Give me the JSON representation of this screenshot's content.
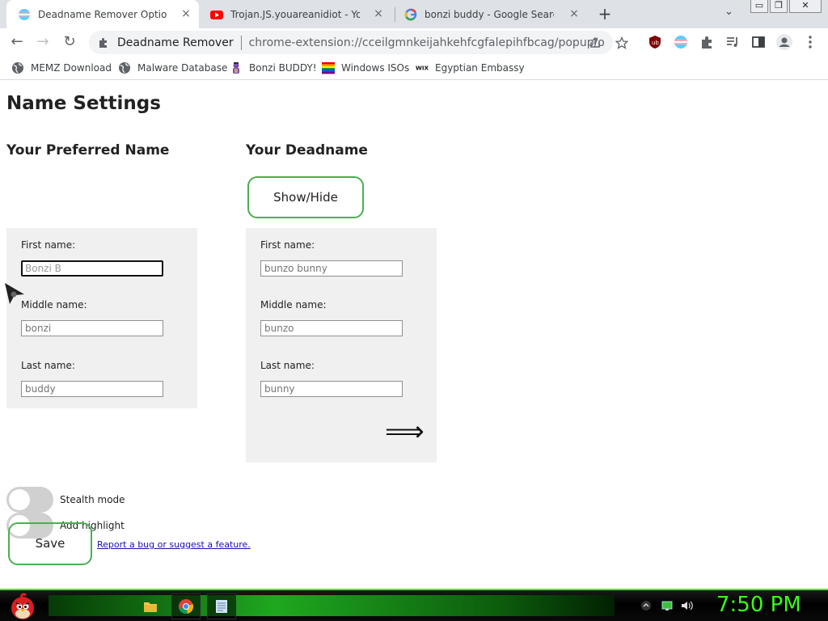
{
  "browser": {
    "tabs": [
      {
        "title": "Deadname Remover Options",
        "icon": "trans-flag-icon",
        "active": true
      },
      {
        "title": "Trojan.JS.youareanidiot - YouTube",
        "icon": "youtube-icon",
        "active": false
      },
      {
        "title": "bonzi buddy - Google Search",
        "icon": "google-icon",
        "active": false
      }
    ],
    "tab_close": "×",
    "new_tab": "+",
    "tab_search": "⌄",
    "window_buttons": [
      "▭",
      "❐",
      "✕"
    ],
    "nav": {
      "back": "←",
      "forward": "→",
      "reload": "↻"
    },
    "omnibox": {
      "site_name": "Deadname Remover",
      "url": "chrome-extension://cceilgmnkeijahkehfcgfalepihfbcag/popup/optio..."
    },
    "bookmarks": [
      {
        "label": "MEMZ Download",
        "icon": "globe-icon"
      },
      {
        "label": "Malware Database",
        "icon": "globe-icon"
      },
      {
        "label": "Bonzi BUDDY!",
        "icon": "bonzi-icon"
      },
      {
        "label": "Windows ISOs",
        "icon": "rainbow-flag-icon"
      },
      {
        "label": "Egyptian Embassy",
        "icon": "wix-icon"
      }
    ]
  },
  "page": {
    "title": "Name Settings",
    "preferred": {
      "heading": "Your Preferred Name",
      "first_label": "First name:",
      "first_value": "Bonzi B",
      "middle_label": "Middle name:",
      "middle_value": "bonzi",
      "last_label": "Last name:",
      "last_value": "buddy"
    },
    "deadname": {
      "heading": "Your Deadname",
      "show_hide": "Show/Hide",
      "first_label": "First name:",
      "first_value": "bunzo bunny",
      "middle_label": "Middle name:",
      "middle_value": "bunzo",
      "last_label": "Last name:",
      "last_value": "bunny",
      "arrow": "⟹"
    },
    "stealth_label": "Stealth mode",
    "stealth_on": false,
    "highlight_label": "Add highlight",
    "highlight_on": false,
    "save": "Save",
    "report_link": "Report a bug or suggest a feature."
  },
  "taskbar": {
    "clock": "7:50 PM",
    "accent": "#39ff14"
  }
}
